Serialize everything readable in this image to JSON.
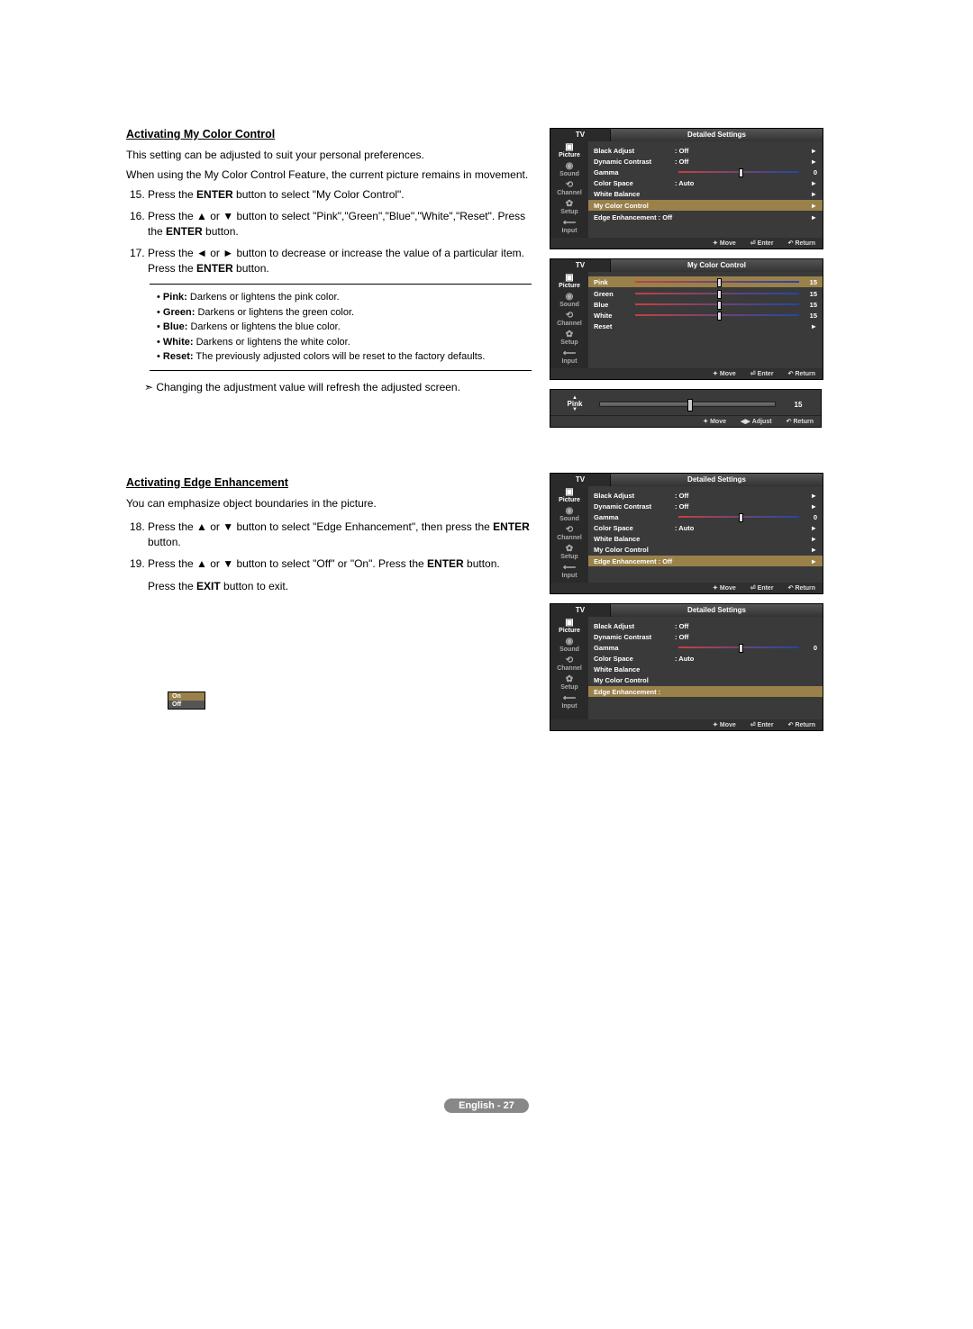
{
  "section1": {
    "title": "Activating My Color Control",
    "intro1": "This setting can be adjusted to suit your personal preferences.",
    "intro2": "When using the My Color Control Feature, the current picture remains in movement.",
    "step15_a": "Press the ",
    "step15_b": "ENTER",
    "step15_c": " button to select \"My Color Control\".",
    "step16_a": "Press the ▲ or ▼ button to select \"Pink\",\"Green\",\"Blue\",\"White\",\"Reset\". Press the ",
    "step16_b": "ENTER",
    "step16_c": " button.",
    "step17_a": "Press the ◄ or ► button to decrease or increase the value of a particular item. Press the ",
    "step17_b": "ENTER",
    "step17_c": " button.",
    "bullets": {
      "pink_b": "Pink:",
      "pink_t": " Darkens or lightens the pink color.",
      "green_b": "Green:",
      "green_t": " Darkens or lightens the green color.",
      "blue_b": "Blue:",
      "blue_t": " Darkens or lightens the blue color.",
      "white_b": "White:",
      "white_t": " Darkens or lightens the white color.",
      "reset_b": "Reset:",
      "reset_t": " The previously adjusted colors will be reset to the factory defaults."
    },
    "note": "Changing the adjustment value will refresh the adjusted screen."
  },
  "section2": {
    "title": "Activating Edge Enhancement",
    "intro": "You can emphasize object boundaries in the picture.",
    "step18_a": "Press the ▲ or ▼ button to select \"Edge Enhancement\", then press the ",
    "step18_b": "ENTER",
    "step18_c": " button.",
    "step19_a": "Press the ▲ or ▼ button to select \"Off\" or \"On\". Press the ",
    "step19_b": "ENTER",
    "step19_c": " button.",
    "exit_a": "Press the ",
    "exit_b": "EXIT",
    "exit_c": " button to exit."
  },
  "tv": {
    "tab": "TV",
    "side": [
      "Picture",
      "Sound",
      "Channel",
      "Setup",
      "Input"
    ],
    "footer": {
      "move": "Move",
      "enter": "Enter",
      "return": "Return",
      "adjust": "Adjust"
    }
  },
  "menu1": {
    "title": "Detailed Settings",
    "rows": {
      "black": {
        "label": "Black Adjust",
        "value": ": Off"
      },
      "dyn": {
        "label": "Dynamic Contrast",
        "value": ": Off"
      },
      "gamma": {
        "label": "Gamma",
        "num": "0"
      },
      "cspace": {
        "label": "Color Space",
        "value": ": Auto"
      },
      "wb": {
        "label": "White Balance"
      },
      "mcc": {
        "label": "My Color Control"
      },
      "edge": {
        "label": "Edge Enhancement : Off"
      }
    }
  },
  "menu2": {
    "title": "My Color Control",
    "rows": {
      "pink": {
        "label": "Pink",
        "num": "15"
      },
      "green": {
        "label": "Green",
        "num": "15"
      },
      "blue": {
        "label": "Blue",
        "num": "15"
      },
      "white": {
        "label": "White",
        "num": "15"
      },
      "reset": {
        "label": "Reset"
      }
    }
  },
  "adjust": {
    "label": "Pink",
    "value": "15"
  },
  "menu3": {
    "title": "Detailed Settings",
    "rows": {
      "black": {
        "label": "Black Adjust",
        "value": ": Off"
      },
      "dyn": {
        "label": "Dynamic Contrast",
        "value": ": Off"
      },
      "gamma": {
        "label": "Gamma",
        "num": "0"
      },
      "cspace": {
        "label": "Color Space",
        "value": ": Auto"
      },
      "wb": {
        "label": "White Balance"
      },
      "mcc": {
        "label": "My Color Control"
      },
      "edge": {
        "label": "Edge Enhancement : Off"
      }
    }
  },
  "menu4": {
    "title": "Detailed Settings",
    "rows": {
      "black": {
        "label": "Black Adjust",
        "value": ": Off"
      },
      "dyn": {
        "label": "Dynamic Contrast",
        "value": ": Off"
      },
      "gamma": {
        "label": "Gamma",
        "num": "0"
      },
      "cspace": {
        "label": "Color Space",
        "value": ": Auto"
      },
      "wb": {
        "label": "White Balance"
      },
      "mcc": {
        "label": "My Color Control"
      },
      "edge": {
        "label": "Edge Enhancement :"
      }
    },
    "dropdown": {
      "on": "On",
      "off": "Off"
    }
  },
  "footer": "English - 27"
}
